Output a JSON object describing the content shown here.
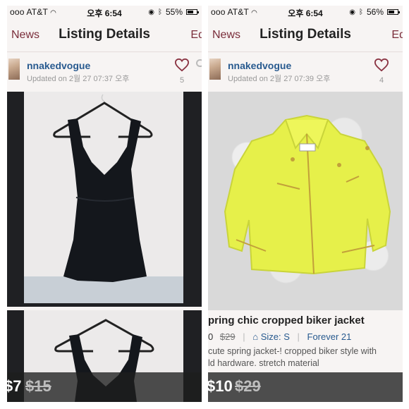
{
  "screens": [
    {
      "status": {
        "carrier": "ooo AT&T",
        "time": "오후 6:54",
        "battery": "55%"
      },
      "nav": {
        "back": "News",
        "title": "Listing Details",
        "edit": "Ed"
      },
      "seller": {
        "username": "nnakedvogue",
        "updated": "Updated on 2월 27 07:37 오후",
        "likes": "5"
      },
      "listing": {
        "price": "$7",
        "original_price": "$15"
      }
    },
    {
      "status": {
        "carrier": "ooo AT&T",
        "time": "오후 6:54",
        "battery": "56%"
      },
      "nav": {
        "back": "News",
        "title": "Listing Details",
        "edit": "Ed"
      },
      "seller": {
        "username": "nnakedvogue",
        "updated": "Updated on 2월 27 07:39 오후",
        "likes": "4"
      },
      "listing": {
        "title": "pring chic cropped biker jacket",
        "price_line": "0",
        "original_price_line": "$29",
        "size": "Size: S",
        "brand": "Forever 21",
        "description": "cute spring jacket-! cropped biker style with\nld hardware. stretch material",
        "price": "$10",
        "original_price": "$29"
      }
    }
  ],
  "colors": {
    "accent": "#7a2d3a",
    "link": "#285a8f",
    "heart": "#8a3342",
    "jacket": "#e6f04a",
    "price_bar": "#2a2a2a"
  },
  "icons": [
    "wifi-icon",
    "alarm-icon",
    "bluetooth-icon",
    "battery-icon",
    "heart-icon",
    "comment-icon",
    "hanger-icon"
  ]
}
